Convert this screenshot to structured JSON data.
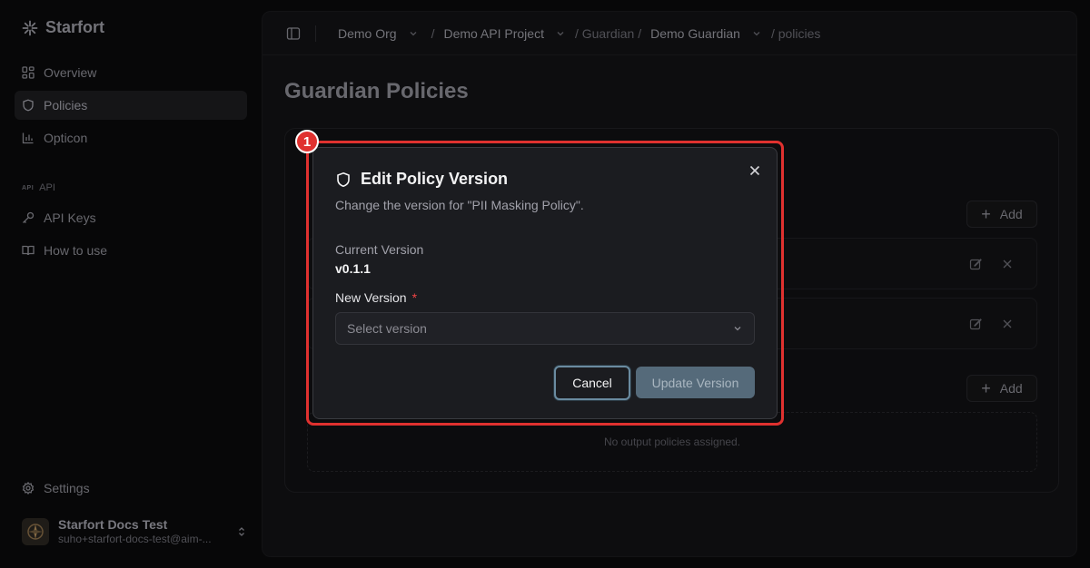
{
  "app": {
    "name": "Starfort"
  },
  "sidebar": {
    "items": [
      {
        "label": "Overview",
        "icon": "grid-icon"
      },
      {
        "label": "Policies",
        "icon": "shield-icon",
        "active": true
      },
      {
        "label": "Opticon",
        "icon": "chart-icon"
      }
    ],
    "section": {
      "glyph": "API",
      "label": "API"
    },
    "api_items": [
      {
        "label": "API Keys",
        "icon": "key-icon"
      },
      {
        "label": "How to use",
        "icon": "book-icon"
      }
    ],
    "settings_label": "Settings",
    "user": {
      "name": "Starfort Docs Test",
      "email": "suho+starfort-docs-test@aim-..."
    }
  },
  "breadcrumb": {
    "org": "Demo Org",
    "project": "Demo API Project",
    "section": "/ Guardian /",
    "guardian": "Demo Guardian",
    "page": "/ policies",
    "sep": "/"
  },
  "page": {
    "title": "Guardian Policies"
  },
  "card": {
    "add_label": "Add",
    "empty_text": "No output policies assigned."
  },
  "modal": {
    "title": "Edit Policy Version",
    "description": "Change the version for \"PII Masking Policy\".",
    "current_label": "Current Version",
    "current_value": "v0.1.1",
    "new_label": "New Version",
    "required_mark": "*",
    "select_placeholder": "Select version",
    "cancel_label": "Cancel",
    "update_label": "Update Version"
  },
  "annotation": {
    "badge": "1",
    "color": "#e0312f"
  }
}
